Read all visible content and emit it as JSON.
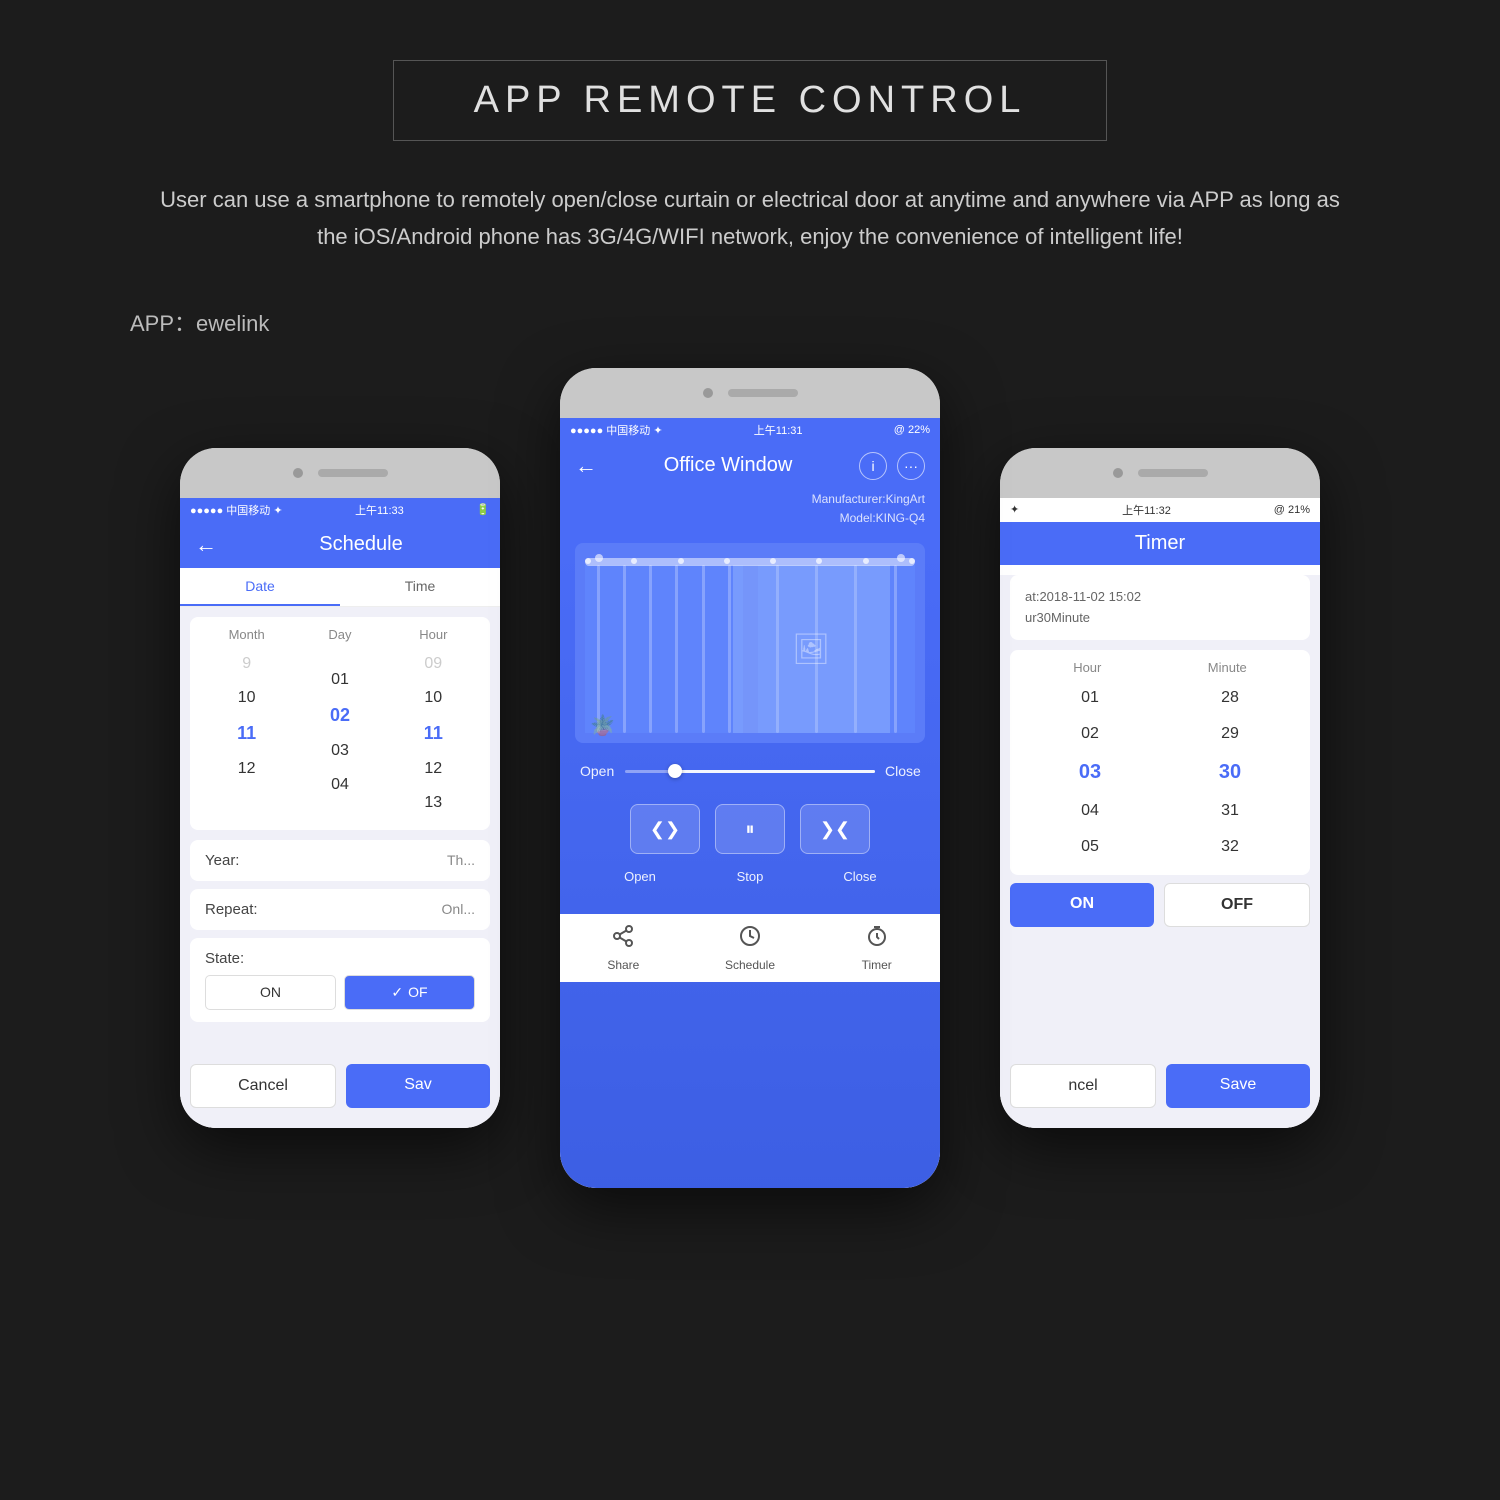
{
  "page": {
    "background_color": "#1c1c1c",
    "title": "APP REMOTE CONTROL",
    "description": "User can use a smartphone to remotely open/close curtain or electrical door at anytime and anywhere via APP as long as the iOS/Android phone has 3G/4G/WIFI network, enjoy the convenience of intelligent life!",
    "app_label": "APP：ewelink"
  },
  "phone_left": {
    "status_bar": {
      "carrier": "●●●●● 中国移动 ✦",
      "time": "上午11:33",
      "battery": ""
    },
    "title": "Schedule",
    "tabs": [
      "Date",
      "Time"
    ],
    "date_picker": {
      "headers": [
        "Month",
        "Day",
        "Hour"
      ],
      "rows": [
        [
          "9",
          "",
          "09"
        ],
        [
          "10",
          "01",
          "10"
        ],
        [
          "11",
          "02",
          "11"
        ],
        [
          "12",
          "03",
          "12"
        ],
        [
          "",
          "04",
          "13"
        ]
      ],
      "selected": [
        2,
        2,
        2
      ]
    },
    "fields": [
      {
        "label": "Year:",
        "value": "Th..."
      },
      {
        "label": "Repeat:",
        "value": "Onl..."
      },
      {
        "label": "State:",
        "value": ""
      }
    ],
    "state_buttons": [
      "ON",
      "OFF"
    ],
    "buttons": [
      "Cancel",
      "Save"
    ]
  },
  "phone_center": {
    "status_bar": {
      "carrier": "●●●●● 中国移动 ✦",
      "time": "上午11:31",
      "battery": "@ 22%"
    },
    "title": "Office Window",
    "manufacturer": "Manufacturer:KingArt",
    "model": "Model:KING-Q4",
    "slider": {
      "left_label": "Open",
      "right_label": "Close"
    },
    "buttons": [
      {
        "label": "Open",
        "icon": "❮❯"
      },
      {
        "label": "Stop",
        "icon": "⏸"
      },
      {
        "label": "Close",
        "icon": "❯❮"
      }
    ],
    "bottom_nav": [
      {
        "label": "Share",
        "icon": "⤴"
      },
      {
        "label": "Schedule",
        "icon": "⏰"
      },
      {
        "label": "Timer",
        "icon": "⏱"
      }
    ]
  },
  "phone_right": {
    "status_bar": {
      "carrier": "✦",
      "time": "上午11:32",
      "battery": "@ 21%"
    },
    "title": "Timer",
    "info": {
      "line1": "at:2018-11-02 15:02",
      "line2": "ur30Minute"
    },
    "timer_picker": {
      "headers": [
        "Hour",
        "Minute"
      ],
      "rows": [
        [
          "01",
          "28"
        ],
        [
          "02",
          "29"
        ],
        [
          "03",
          "30"
        ],
        [
          "04",
          "31"
        ],
        [
          "05",
          "32"
        ]
      ],
      "selected": [
        2,
        2
      ]
    },
    "onoff_buttons": [
      "ON",
      "OFF"
    ],
    "buttons": [
      "ncel",
      "Save"
    ]
  },
  "icons": {
    "back_arrow": "←",
    "info_circle": "ℹ",
    "more": "···",
    "open_icon": "❮❯",
    "stop_icon": "⏸",
    "close_icon": "❯❮",
    "share_icon": "⤴",
    "schedule_icon": "⏰",
    "timer_icon": "⏱",
    "check_icon": "✓"
  }
}
